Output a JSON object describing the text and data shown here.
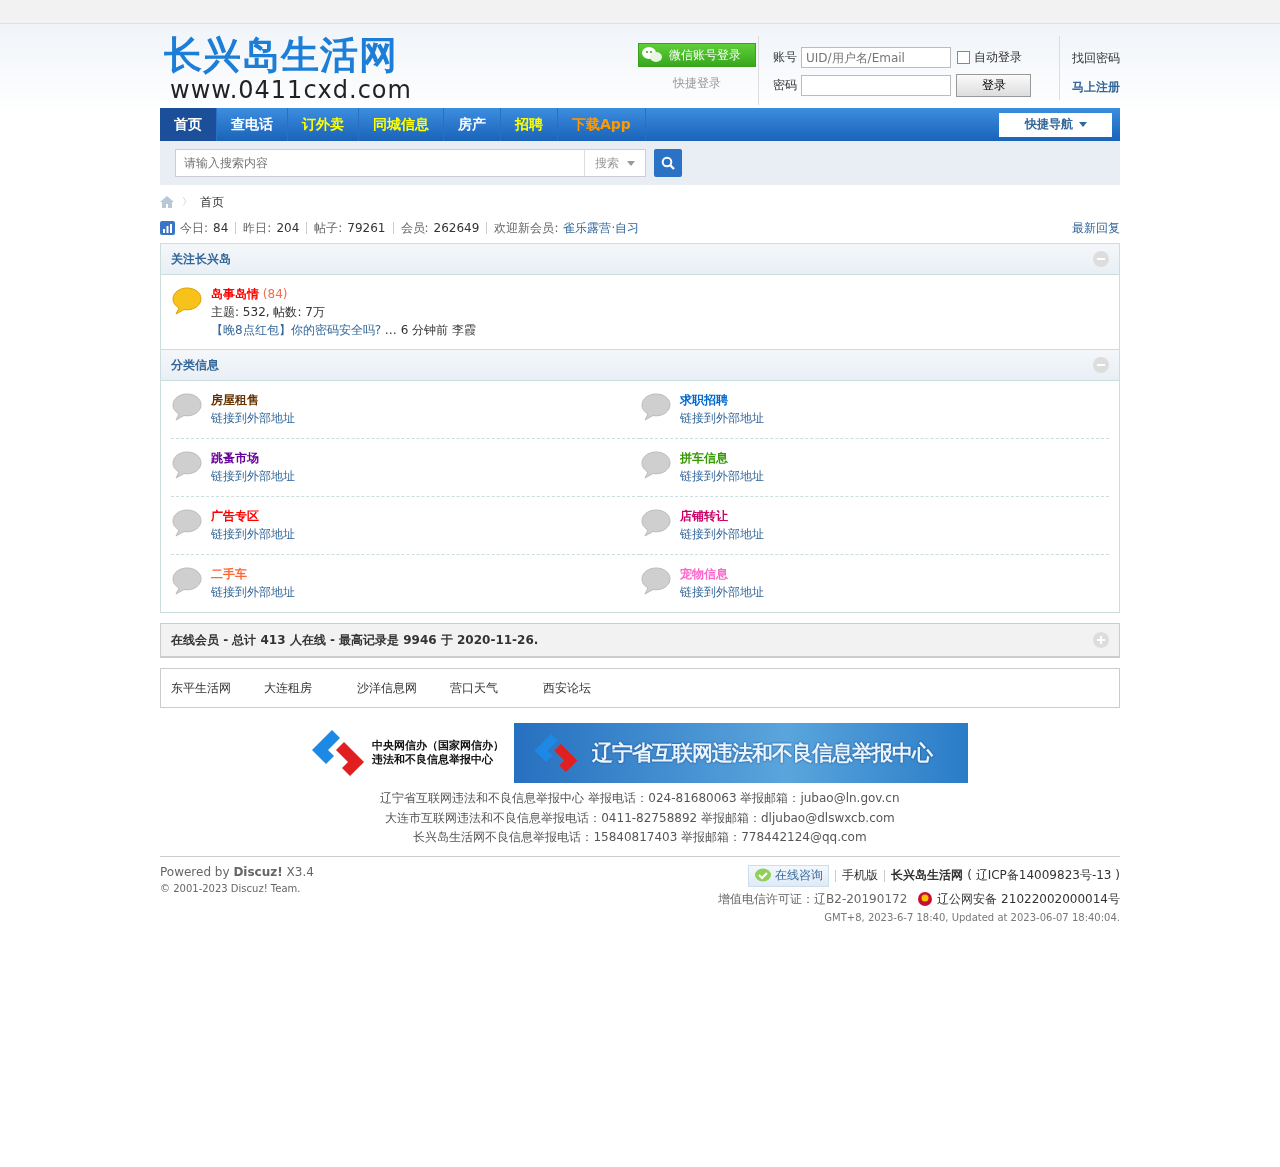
{
  "logo": {
    "title": "长兴岛生活网",
    "url": "www.0411cxd.com"
  },
  "login": {
    "wechat_button": "微信账号登录",
    "quick_login": "快捷登录",
    "account_label": "账号",
    "account_placeholder": "UID/用户名/Email",
    "auto_login": {
      "label": "自动登录",
      "checked": false
    },
    "password_label": "密码",
    "login_button": "登录",
    "forgot": "找回密码",
    "register": "马上注册"
  },
  "nav": {
    "items": [
      {
        "label": "首页",
        "selected": true,
        "kind": "plain"
      },
      {
        "label": "查电话",
        "selected": false,
        "kind": "plain"
      },
      {
        "label": "订外卖",
        "selected": false,
        "kind": "highlight"
      },
      {
        "label": "同城信息",
        "selected": false,
        "kind": "highlight"
      },
      {
        "label": "房产",
        "selected": false,
        "kind": "plain"
      },
      {
        "label": "招聘",
        "selected": false,
        "kind": "highlight"
      },
      {
        "label": "下载App",
        "selected": false,
        "kind": "promo"
      }
    ],
    "quick_nav": "快捷导航"
  },
  "search": {
    "placeholder": "请输入搜索内容",
    "scope": "搜索"
  },
  "breadcrumb": {
    "separator": "〉",
    "items": [
      "首页"
    ]
  },
  "stats": [
    {
      "label": "今日:",
      "value": "84"
    },
    {
      "label": "昨日:",
      "value": "204"
    },
    {
      "label": "帖子:",
      "value": "79261"
    },
    {
      "label": "会员:",
      "value": "262649"
    },
    {
      "label": "欢迎新会员:",
      "value": "雀乐露营·自习"
    }
  ],
  "latest_replies": "最新回复",
  "group1": {
    "title": "关注长兴岛",
    "expanded": true,
    "forum": {
      "name": "岛事岛情",
      "count": "(84)",
      "stats": "主题: 532, 帖数: 7万",
      "last_post": "【晚8点红包】你的密码安全吗?",
      "last_meta": "… 6 分钟前 李霞"
    }
  },
  "group2": {
    "title": "分类信息",
    "expanded": true,
    "forums": [
      {
        "name": "房屋租售",
        "color": "#663300",
        "link": "链接到外部地址"
      },
      {
        "name": "求职招聘",
        "color": "#0066cc",
        "link": "链接到外部地址"
      },
      {
        "name": "跳蚤市场",
        "color": "#660099",
        "link": "链接到外部地址"
      },
      {
        "name": "拼车信息",
        "color": "#339900",
        "link": "链接到外部地址"
      },
      {
        "name": "广告专区",
        "color": "#ff0000",
        "link": "链接到外部地址"
      },
      {
        "name": "店铺转让",
        "color": "#cc0066",
        "link": "链接到外部地址"
      },
      {
        "name": "二手车",
        "color": "#ff6633",
        "link": "链接到外部地址"
      },
      {
        "name": "宠物信息",
        "color": "#ff66cc",
        "link": "链接到外部地址"
      }
    ]
  },
  "online": {
    "text": "在线会员 - 总计 413 人在线 - 最高记录是 9946 于 2020-11-26.",
    "expanded": false
  },
  "links": [
    "东平生活网",
    "大连租房",
    "沙洋信息网",
    "营口天气",
    "西安论坛"
  ],
  "banners": {
    "left": [
      "中央网信办（国家网信办）",
      "违法和不良信息举报中心"
    ],
    "right": "辽宁省互联网违法和不良信息举报中心"
  },
  "report_lines": [
    "辽宁省互联网违法和不良信息举报中心 举报电话：024-81680063 举报邮箱：jubao@ln.gov.cn",
    "大连市互联网违法和不良信息举报电话：0411-82758892 举报邮箱：dljubao@dlswxcb.com",
    "长兴岛生活网不良信息举报电话：15840817403 举报邮箱：778442124@qq.com"
  ],
  "footer": {
    "powered": "Powered by **Discuz!** X3.4",
    "copyright": "© 2001-2023 Discuz! Team.",
    "consult": "在线咨询",
    "mobile": "手机版",
    "site": "长兴岛生活网",
    "icp": "( 辽ICP备14009823号-13 )",
    "license": "增值电信许可证：辽B2-20190172",
    "police": "辽公网安备 21022002000014号",
    "time": "GMT+8, 2023-6-7 18:40, Updated at 2023-06-07 18:40:04."
  }
}
